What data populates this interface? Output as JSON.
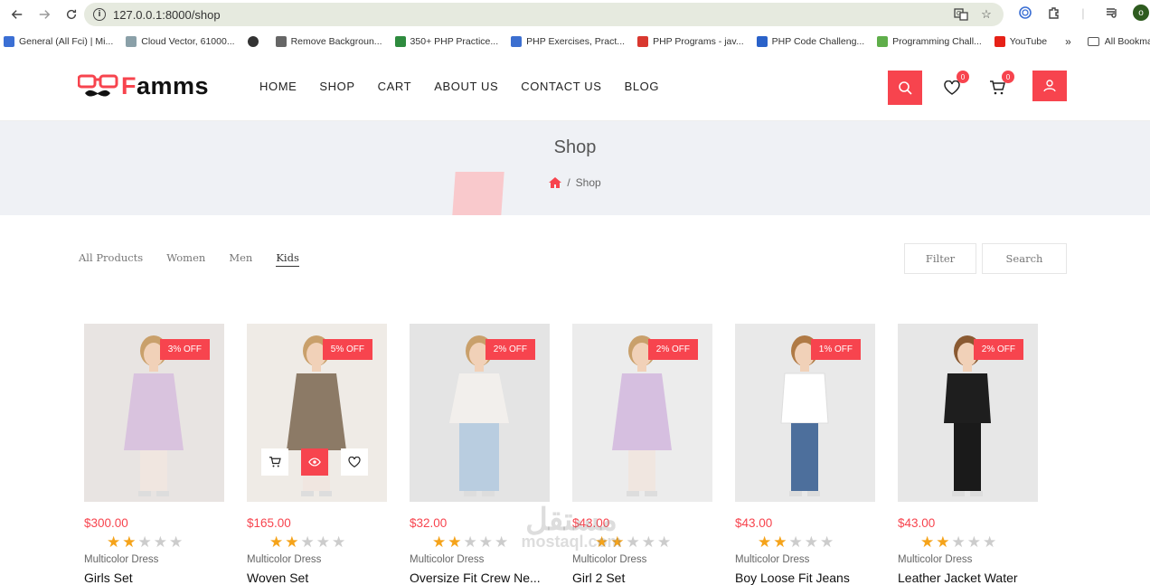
{
  "browser": {
    "url": "127.0.0.1:8000/shop",
    "profile_initial": "o",
    "bookmarks": [
      {
        "label": "General (All Fci) | Mi...",
        "color": "#3b6fd4"
      },
      {
        "label": "Cloud Vector, 61000...",
        "color": "#8aa0a8"
      },
      {
        "label": "",
        "color": "#333333"
      },
      {
        "label": "Remove Backgroun...",
        "color": "#666666"
      },
      {
        "label": "350+ PHP Practice...",
        "color": "#2e8b3e"
      },
      {
        "label": "PHP Exercises, Pract...",
        "color": "#3c6fd0"
      },
      {
        "label": "PHP Programs - jav...",
        "color": "#d9382f"
      },
      {
        "label": "PHP Code Challeng...",
        "color": "#2a62c9"
      },
      {
        "label": "Programming Chall...",
        "color": "#5fae4a"
      },
      {
        "label": "YouTube",
        "color": "#e62117"
      }
    ],
    "more": "»",
    "all_bookmarks": "All Bookmarks"
  },
  "site": {
    "brand_first": "F",
    "brand_rest": "amms",
    "nav": [
      "HOME",
      "SHOP",
      "CART",
      "ABOUT US",
      "CONTACT US",
      "BLOG"
    ],
    "wishlist_count": "0",
    "cart_count": "0",
    "accent": "#f7444e"
  },
  "banner": {
    "title": "Shop",
    "crumb": "Shop",
    "sep": "/"
  },
  "filters": {
    "tabs": [
      "All Products",
      "Women",
      "Men",
      "Kids"
    ],
    "active_tab": "Kids",
    "filter_label": "Filter",
    "search_label": "Search"
  },
  "products": [
    {
      "off": "3% OFF",
      "price": "$300.00",
      "rating": 2,
      "sub": "Multicolor Dress",
      "name": "Girls Set",
      "dress": "#d9c3de",
      "bg": "#e8e4e2"
    },
    {
      "off": "5% OFF",
      "price": "$165.00",
      "rating": 2,
      "sub": "Multicolor Dress",
      "name": "Woven Set",
      "dress": "#8c7a66",
      "bg": "#efebe6"
    },
    {
      "off": "2% OFF",
      "price": "$32.00",
      "rating": 2,
      "sub": "Multicolor Dress",
      "name": "Oversize Fit Crew Ne...",
      "dress": "#f2efec",
      "bg": "#e4e4e4"
    },
    {
      "off": "2% OFF",
      "price": "$43.00",
      "rating": 2,
      "sub": "Multicolor Dress",
      "name": "Girl 2 Set",
      "dress": "#d6bfe0",
      "bg": "#ececec"
    },
    {
      "off": "1% OFF",
      "price": "$43.00",
      "rating": 2,
      "sub": "Multicolor Dress",
      "name": "Boy Loose Fit Jeans",
      "dress": "#ffffff",
      "bg": "#e9e9e9"
    },
    {
      "off": "2% OFF",
      "price": "$43.00",
      "rating": 2,
      "sub": "Multicolor Dress",
      "name": "Leather Jacket Water",
      "dress": "#1e1e1e",
      "bg": "#e7e7e7"
    }
  ],
  "watermark": {
    "line1": "مستقل",
    "line2": "mostaql.com"
  }
}
